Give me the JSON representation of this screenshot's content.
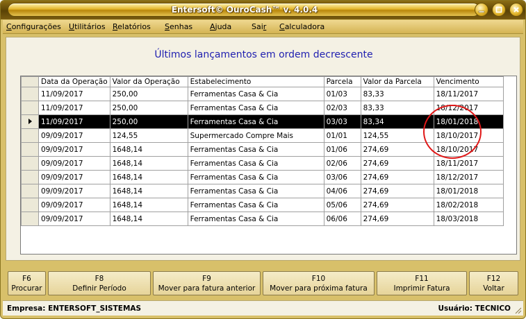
{
  "window": {
    "title": "Entersoft© OuroCash™ v. 4.0.4"
  },
  "menu": [
    {
      "label": "Configurações",
      "u": "C",
      "rest": "onfigurações"
    },
    {
      "label": "Utilitários",
      "u": "U",
      "rest": "tilitários"
    },
    {
      "label": "Relatórios",
      "u": "R",
      "rest": "elatórios"
    },
    {
      "label": "Senhas",
      "u": "S",
      "rest": "enhas"
    },
    {
      "label": "Ajuda",
      "u": "A",
      "rest": "juda"
    },
    {
      "label": "Sair",
      "u": "",
      "rest": ""
    },
    {
      "label": "Calculadora",
      "u": "C",
      "rest": "alculadora"
    }
  ],
  "menu_sair": {
    "pre": "Sai",
    "u": "r"
  },
  "heading": "Últimos lançamentos em ordem decrescente",
  "table": {
    "columns": [
      "Data da Operação",
      "Valor da Operação",
      "Estabelecimento",
      "Parcela",
      "Valor da Parcela",
      "Vencimento"
    ],
    "rows": [
      [
        "11/09/2017",
        "250,00",
        "Ferramentas Casa & Cia",
        "01/03",
        "83,33",
        "18/11/2017"
      ],
      [
        "11/09/2017",
        "250,00",
        "Ferramentas Casa & Cia",
        "02/03",
        "83,33",
        "18/12/2017"
      ],
      [
        "11/09/2017",
        "250,00",
        "Ferramentas Casa & Cia",
        "03/03",
        "83,34",
        "18/01/2018"
      ],
      [
        "09/09/2017",
        "124,55",
        "Supermercado Compre Mais",
        "01/01",
        "124,55",
        "18/10/2017"
      ],
      [
        "09/09/2017",
        "1648,14",
        "Ferramentas Casa & Cia",
        "01/06",
        "274,69",
        "18/10/2017"
      ],
      [
        "09/09/2017",
        "1648,14",
        "Ferramentas Casa & Cia",
        "02/06",
        "274,69",
        "18/11/2017"
      ],
      [
        "09/09/2017",
        "1648,14",
        "Ferramentas Casa & Cia",
        "03/06",
        "274,69",
        "18/12/2017"
      ],
      [
        "09/09/2017",
        "1648,14",
        "Ferramentas Casa & Cia",
        "04/06",
        "274,69",
        "18/01/2018"
      ],
      [
        "09/09/2017",
        "1648,14",
        "Ferramentas Casa & Cia",
        "05/06",
        "274,69",
        "18/02/2018"
      ],
      [
        "09/09/2017",
        "1648,14",
        "Ferramentas Casa & Cia",
        "06/06",
        "274,69",
        "18/03/2018"
      ]
    ],
    "selected_row": 2
  },
  "buttons": [
    {
      "key": "F6",
      "label": "Procurar"
    },
    {
      "key": "F8",
      "label": "Definir Período"
    },
    {
      "key": "F9",
      "label": "Mover para fatura anterior"
    },
    {
      "key": "F10",
      "label": "Mover para próxima fatura"
    },
    {
      "key": "F11",
      "label": "Imprimir Fatura"
    },
    {
      "key": "F12",
      "label": "Voltar"
    }
  ],
  "status": {
    "empresa": "Empresa: ENTERSOFT_SISTEMAS",
    "usuario": "Usuário: TECNICO"
  },
  "colors": {
    "heading": "#1f1fb0",
    "highlight_circle": "#e01818",
    "selected_row_bg": "#000000"
  }
}
